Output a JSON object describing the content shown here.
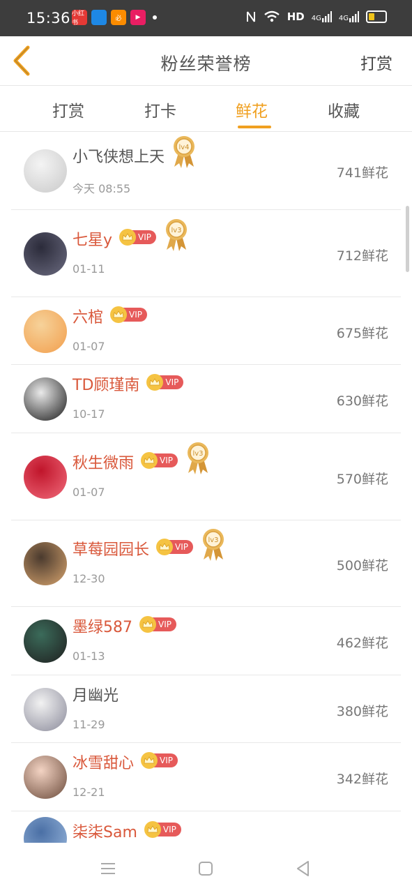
{
  "status_bar": {
    "time": "15:36",
    "apps": [
      {
        "name": "app-icon-1",
        "color": "#e53935",
        "label": "小红书"
      },
      {
        "name": "app-icon-2",
        "color": "#1e88e5",
        "label": ""
      },
      {
        "name": "app-icon-3",
        "color": "#fb8c00",
        "label": "必"
      },
      {
        "name": "app-icon-4",
        "color": "#e91e63",
        "label": "▶"
      }
    ],
    "signal_text": "HD",
    "net1": "4G",
    "net2": "4G"
  },
  "nav": {
    "title": "粉丝荣誉榜",
    "action": "打赏"
  },
  "tabs": [
    "打赏",
    "打卡",
    "鲜花",
    "收藏"
  ],
  "active_tab_index": 2,
  "fans": [
    {
      "name": "小飞侠想上天",
      "date": "今天 08:55",
      "flowers": "741鲜花",
      "vip": false,
      "level": "lv4",
      "avatar_colors": [
        "#f4f4f4",
        "#c9c9c9"
      ]
    },
    {
      "name": "七星y",
      "date": "01-11",
      "flowers": "712鲜花",
      "vip": true,
      "vip_label": "VIP",
      "level": "lv3",
      "avatar_colors": [
        "#2b2b3a",
        "#6b6b80"
      ]
    },
    {
      "name": "六棺",
      "date": "01-07",
      "flowers": "675鲜花",
      "vip": true,
      "vip_label": "VIP",
      "level": null,
      "avatar_colors": [
        "#f6d29a",
        "#f29e4c"
      ]
    },
    {
      "name": "TD顾瑾南",
      "date": "10-17",
      "flowers": "630鲜花",
      "vip": true,
      "vip_label": "VIP",
      "level": null,
      "avatar_colors": [
        "#eaeaea",
        "#1a1a1a"
      ]
    },
    {
      "name": "秋生微雨",
      "date": "01-07",
      "flowers": "570鲜花",
      "vip": true,
      "vip_label": "VIP",
      "level": "lv3",
      "avatar_colors": [
        "#c0152b",
        "#f06a7a"
      ]
    },
    {
      "name": "草莓园园长",
      "date": "12-30",
      "flowers": "500鲜花",
      "vip": true,
      "vip_label": "VIP",
      "level": "lv3",
      "avatar_colors": [
        "#4a3a2e",
        "#d7a46e"
      ]
    },
    {
      "name": "墨绿587",
      "date": "01-13",
      "flowers": "462鲜花",
      "vip": true,
      "vip_label": "VIP",
      "level": null,
      "avatar_colors": [
        "#3b6b5a",
        "#1f1f1f"
      ]
    },
    {
      "name": "月幽光",
      "date": "11-29",
      "flowers": "380鲜花",
      "vip": false,
      "level": null,
      "avatar_colors": [
        "#f2f2f2",
        "#8a8a9a"
      ]
    },
    {
      "name": "冰雪甜心",
      "date": "12-21",
      "flowers": "342鲜花",
      "vip": true,
      "vip_label": "VIP",
      "level": null,
      "avatar_colors": [
        "#f3d3c3",
        "#6a4a3a"
      ]
    },
    {
      "name": "柒柒Sam",
      "date": "",
      "flowers": "",
      "vip": true,
      "vip_label": "VIP",
      "level": null,
      "avatar_colors": [
        "#4a6fa5",
        "#9ab8dd"
      ]
    }
  ],
  "colors": {
    "accent": "#f0a020",
    "vip_name": "#d9583b",
    "vip_badge": "#e65a5a",
    "crown": "#f5c342",
    "medal": "#e0a84a"
  }
}
